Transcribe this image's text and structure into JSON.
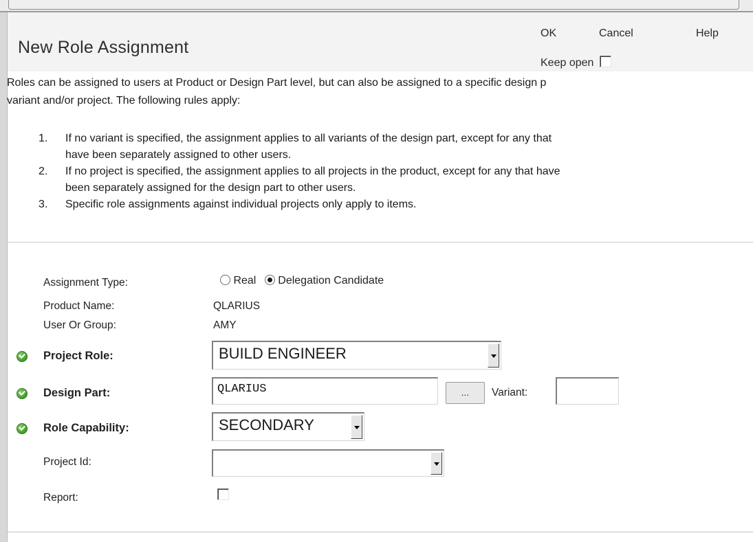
{
  "page": {
    "title": "New Role Assignment",
    "actions": {
      "ok": "OK",
      "cancel": "Cancel",
      "help": "Help",
      "keep_open": "Keep open"
    }
  },
  "description": {
    "line1": "Roles can be assigned to users at Product or Design Part level, but can also be assigned to a specific design p",
    "line2": "variant and/or project. The following rules apply:"
  },
  "rules": [
    {
      "num": "1.",
      "line1": "If no variant is specified, the assignment applies to all variants of the design part, except for any that",
      "line2": "have been separately assigned to other users."
    },
    {
      "num": "2.",
      "line1": "If no project is specified, the assignment applies to all projects in the product, except for any that have",
      "line2": "been separately assigned for the design part to other users."
    },
    {
      "num": "3.",
      "line1": "Specific role assignments against individual projects only apply to items."
    }
  ],
  "form": {
    "assignment_type": {
      "label": "Assignment Type:",
      "options": [
        "Real",
        "Delegation Candidate"
      ],
      "selected": "Delegation Candidate"
    },
    "product_name": {
      "label": "Product Name:",
      "value": "QLARIUS"
    },
    "user_or_group": {
      "label": "User Or Group:",
      "value": "AMY"
    },
    "project_role": {
      "label": "Project Role:",
      "value": "BUILD ENGINEER",
      "required": true
    },
    "design_part": {
      "label": "Design Part:",
      "value": "QLARIUS",
      "browse": "...",
      "required": true,
      "variant_label": "Variant:",
      "variant_value": ""
    },
    "role_capability": {
      "label": "Role Capability:",
      "value": "SECONDARY",
      "required": true
    },
    "project_id": {
      "label": "Project Id:",
      "value": ""
    },
    "report": {
      "label": "Report:",
      "checked": false
    }
  }
}
